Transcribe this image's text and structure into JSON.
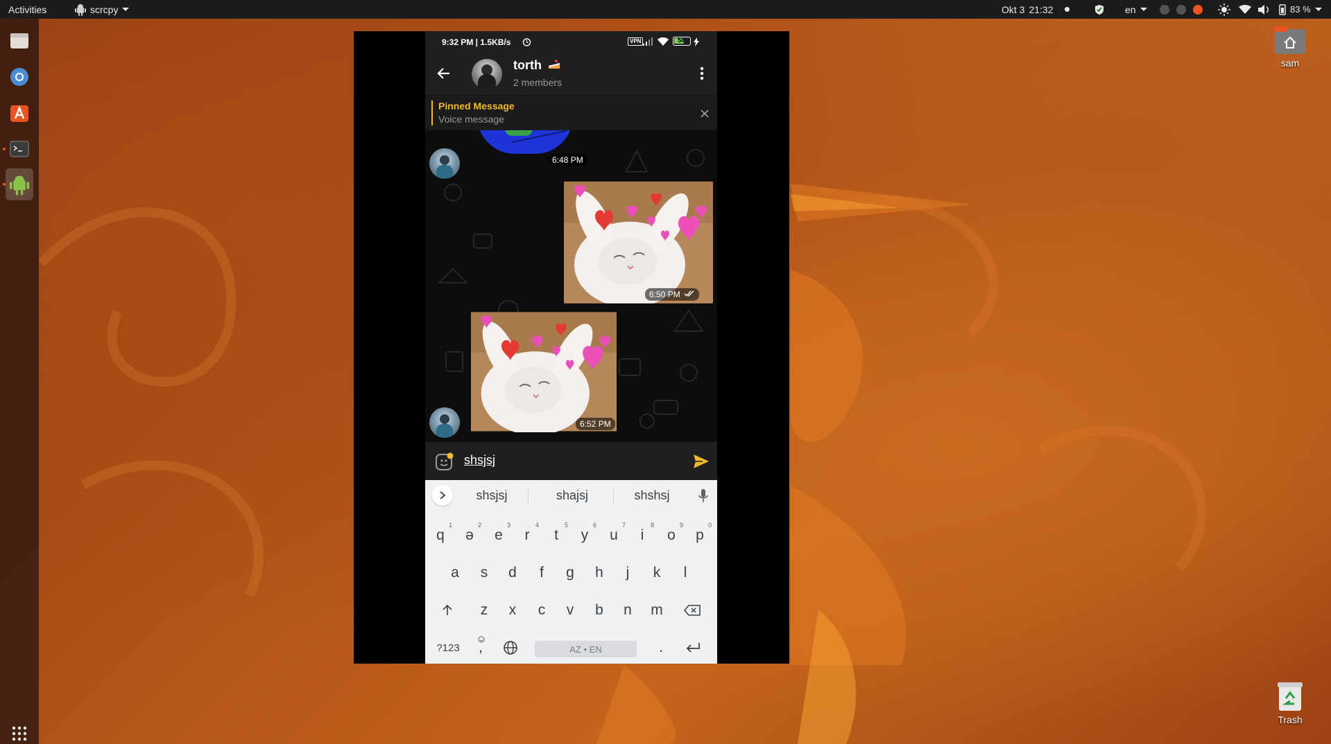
{
  "topbar": {
    "activities": "Activities",
    "app_name": "scrcpy",
    "date": "Okt 3",
    "time": "21:32",
    "lang": "en",
    "battery": "83 %"
  },
  "desktop": {
    "home_label": "sam",
    "trash_label": "Trash"
  },
  "phone": {
    "status": {
      "time": "9:32 PM | 1.5KB/s",
      "vpn": "VPN",
      "battery": "58"
    },
    "header": {
      "name": "torth",
      "subtitle": "2 members"
    },
    "pinned": {
      "title": "Pinned Message",
      "preview": "Voice message"
    },
    "messages": [
      {
        "time": "6:48 PM"
      },
      {
        "time": "6:50 PM"
      },
      {
        "time": "6:52 PM"
      }
    ],
    "composer": {
      "text": "shsjsj"
    },
    "keyboard": {
      "suggestions": [
        "shsjsj",
        "shajsj",
        "shshsj"
      ],
      "row1": [
        {
          "k": "q",
          "n": "1"
        },
        {
          "k": "ə",
          "n": "2"
        },
        {
          "k": "e",
          "n": "3"
        },
        {
          "k": "r",
          "n": "4"
        },
        {
          "k": "t",
          "n": "5"
        },
        {
          "k": "y",
          "n": "6"
        },
        {
          "k": "u",
          "n": "7"
        },
        {
          "k": "i",
          "n": "8"
        },
        {
          "k": "o",
          "n": "9"
        },
        {
          "k": "p",
          "n": "0"
        }
      ],
      "row2": [
        "a",
        "s",
        "d",
        "f",
        "g",
        "h",
        "j",
        "k",
        "l"
      ],
      "row3": [
        "z",
        "x",
        "c",
        "v",
        "b",
        "n",
        "m"
      ],
      "symbols_key": "?123",
      "comma_key": ",",
      "space_label": "AZ • EN",
      "period_key": "."
    }
  },
  "colors": {
    "accent_yellow": "#f2b830",
    "ubuntu_orange": "#e95420",
    "topbar_bg": "#1c1c1c"
  }
}
